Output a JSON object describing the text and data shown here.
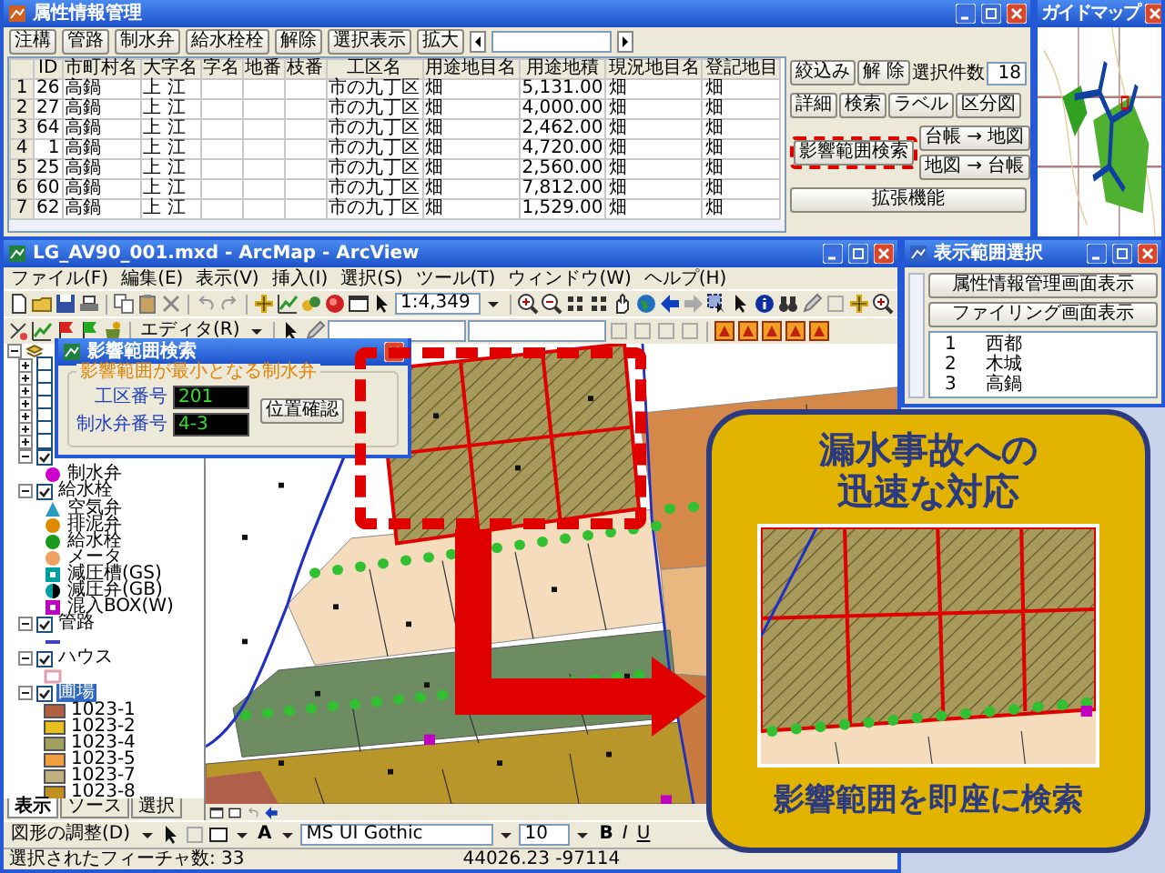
{
  "attribute_window": {
    "title": "属性情報管理",
    "toolbar": [
      "注構",
      "管路",
      "制水弁",
      "給水栓栓",
      "解除",
      "選択表示",
      "拡大"
    ],
    "columns": [
      "ID",
      "市町村名",
      "大字名",
      "字名",
      "地番",
      "枝番",
      "工区名",
      "用途地目名",
      "用途地積",
      "現況地目名",
      "登記地目"
    ],
    "rows": [
      {
        "number": "1",
        "id": "26",
        "city": "高鍋",
        "oaza": "上 江",
        "district": "市の九丁区",
        "use_type": "畑",
        "use_area": "5,131.00",
        "current_type": "畑",
        "registered_type": "畑"
      },
      {
        "number": "2",
        "id": "27",
        "city": "高鍋",
        "oaza": "上 江",
        "district": "市の九丁区",
        "use_type": "畑",
        "use_area": "4,000.00",
        "current_type": "畑",
        "registered_type": "畑"
      },
      {
        "number": "3",
        "id": "64",
        "city": "高鍋",
        "oaza": "上 江",
        "district": "市の九丁区",
        "use_type": "畑",
        "use_area": "2,462.00",
        "current_type": "畑",
        "registered_type": "畑"
      },
      {
        "number": "4",
        "id": "1",
        "city": "高鍋",
        "oaza": "上 江",
        "district": "市の九丁区",
        "use_type": "畑",
        "use_area": "4,720.00",
        "current_type": "畑",
        "registered_type": "畑"
      },
      {
        "number": "5",
        "id": "25",
        "city": "高鍋",
        "oaza": "上 江",
        "district": "市の九丁区",
        "use_type": "畑",
        "use_area": "2,560.00",
        "current_type": "畑",
        "registered_type": "畑"
      },
      {
        "number": "6",
        "id": "60",
        "city": "高鍋",
        "oaza": "上 江",
        "district": "市の九丁区",
        "use_type": "畑",
        "use_area": "7,812.00",
        "current_type": "畑",
        "registered_type": "畑"
      },
      {
        "number": "7",
        "id": "62",
        "city": "高鍋",
        "oaza": "上 江",
        "district": "市の九丁区",
        "use_type": "畑",
        "use_area": "1,529.00",
        "current_type": "畑",
        "registered_type": "畑"
      }
    ],
    "panel": {
      "filter_buttons": [
        "絞込み",
        "解 除"
      ],
      "count_label": "選択件数",
      "count": "18",
      "view_buttons": [
        "詳細",
        "検索",
        "ラベル",
        "区分図"
      ],
      "impact_search_button": "影響範囲検索",
      "link_buttons": [
        "台帳 → 地図",
        "地図 → 台帳"
      ],
      "extension_button": "拡張機能"
    }
  },
  "guide_map": {
    "title": "ガイドマップ"
  },
  "arcmap": {
    "title": "LG_AV90_001.mxd - ArcMap - ArcView",
    "menu": [
      "ファイル(F)",
      "編集(E)",
      "表示(V)",
      "挿入(I)",
      "選択(S)",
      "ツール(T)",
      "ウィンドウ(W)",
      "ヘルプ(H)"
    ],
    "scale": "1:4,349",
    "editor_menu": "エディタ(R)",
    "toc": {
      "layers": [
        {
          "checked": false,
          "expanded": false
        },
        {
          "checked": false,
          "expanded": false
        },
        {
          "checked": false,
          "expanded": false
        },
        {
          "checked": false,
          "expanded": false
        },
        {
          "checked": false,
          "expanded": false
        },
        {
          "checked": false,
          "expanded": false
        },
        {
          "checked": false,
          "expanded": false
        },
        {
          "checked": true,
          "expanded": true,
          "children": [
            {
              "label": "制水弁",
              "kind": "circle",
              "color": "#cc00cc"
            }
          ]
        },
        {
          "label": "給水栓",
          "checked": true,
          "expanded": true,
          "selected": false,
          "children": [
            {
              "label": "空気弁",
              "kind": "triangle",
              "color": "#2a9ac0"
            },
            {
              "label": "排泥弁",
              "kind": "circle",
              "color": "#e08a00"
            },
            {
              "label": "給水栓",
              "kind": "circle",
              "color": "#1a9a1a"
            },
            {
              "label": "メータ",
              "kind": "circle",
              "color": "#f0a060"
            },
            {
              "label": "減圧槽(GS)",
              "kind": "square",
              "color": "#00a0a0"
            },
            {
              "label": "減圧弁(GB)",
              "kind": "half",
              "color": "#00a0a0"
            },
            {
              "label": "混入BOX(W)",
              "kind": "square",
              "color": "#c000c0"
            }
          ]
        },
        {
          "label": "管路",
          "checked": true,
          "expanded": true,
          "selected": false,
          "children": [
            {
              "kind": "line",
              "color": "#4040c0"
            }
          ]
        },
        {
          "label": "ハウス",
          "checked": true,
          "expanded": true,
          "selected": false,
          "children": [
            {
              "kind": "rect",
              "color": "#e0a0b0"
            }
          ]
        },
        {
          "label": "圃場",
          "checked": true,
          "expanded": true,
          "selected": true,
          "children": [
            {
              "label": "1023-1",
              "kind": "patch",
              "color": "#b06040"
            },
            {
              "label": "1023-2",
              "kind": "patch",
              "color": "#e8c020"
            },
            {
              "label": "1023-4",
              "kind": "patch",
              "color": "#a0a060"
            },
            {
              "label": "1023-5",
              "kind": "patch",
              "color": "#f0a040"
            },
            {
              "label": "1023-7",
              "kind": "patch",
              "color": "#c0b080"
            },
            {
              "label": "1023-8",
              "kind": "patch",
              "color": "#c09020"
            }
          ]
        }
      ]
    },
    "toc_tabs": [
      {
        "label": "表示",
        "selected": true
      },
      {
        "label": "ソース",
        "selected": false
      },
      {
        "label": "選択",
        "selected": false
      }
    ],
    "drawing_toolbar": {
      "menu": "図形の調整(D)",
      "text_tool": "A",
      "font": "MS UI Gothic",
      "font_size": "10",
      "styles": [
        "B",
        "I",
        "U"
      ]
    },
    "status": {
      "selection": "選択されたフィーチャ数: 33",
      "coordinates": "44026.23  -97114"
    }
  },
  "impact_dialog": {
    "title": "影響範囲検索",
    "group_label": "影響範囲が最小となる制水弁",
    "fields": [
      {
        "label": "工区番号",
        "value": "201"
      },
      {
        "label": "制水弁番号",
        "value": "4-3"
      }
    ],
    "button": "位置確認"
  },
  "range_window": {
    "title": "表示範囲選択",
    "buttons": [
      "属性情報管理画面表示",
      "ファイリング画面表示"
    ],
    "list": [
      {
        "number": "1",
        "name": "西都"
      },
      {
        "number": "2",
        "name": "木城"
      },
      {
        "number": "3",
        "name": "高鍋"
      }
    ]
  },
  "callout": {
    "title_lines": [
      "漏水事故への",
      "迅速な対応"
    ],
    "caption": "影響範囲を即座に検索"
  }
}
